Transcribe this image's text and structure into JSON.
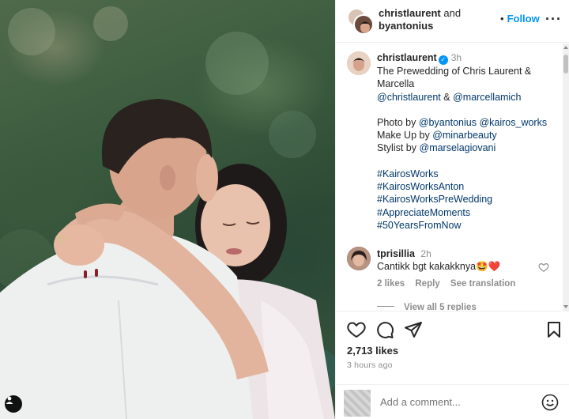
{
  "header": {
    "user1": "christlaurent",
    "and_text": "and",
    "user2": "byantonius",
    "separator": "•",
    "follow_label": "Follow",
    "more_label": "···"
  },
  "caption": {
    "username": "christlaurent",
    "verified_mark": "✓",
    "time": "3h",
    "line1": "The Prewedding of Chris Laurent &",
    "line2": "Marcella",
    "mention1": "@christlaurent",
    "amp": "&",
    "mention2": "@marcellamich",
    "photo_label": "Photo by",
    "photo_m1": "@byantonius",
    "photo_m2": "@kairos_works",
    "makeup_label": "Make Up by",
    "makeup_m": "@minarbeauty",
    "stylist_label": "Stylist by",
    "stylist_m": "@marselagiovani",
    "hashtags": [
      "#KairosWorks",
      "#KairosWorksAnton",
      "#KairosWorksPreWedding",
      "#AppreciateMoments",
      "#50YearsFromNow"
    ]
  },
  "comment": {
    "username": "tprisillia",
    "time": "2h",
    "text": "Cantikk bgt kakakknya🤩❤️",
    "likes": "2 likes",
    "reply": "Reply",
    "translate": "See translation",
    "view_replies": "View all 5 replies"
  },
  "actions": {
    "likes": "2,713 likes",
    "time_ago": "3 hours ago"
  },
  "add_comment": {
    "placeholder": "Add a comment..."
  },
  "colors": {
    "accent": "#0095f6",
    "link": "#00376b",
    "muted": "#8e8e8e",
    "heart": "#ed4956"
  }
}
